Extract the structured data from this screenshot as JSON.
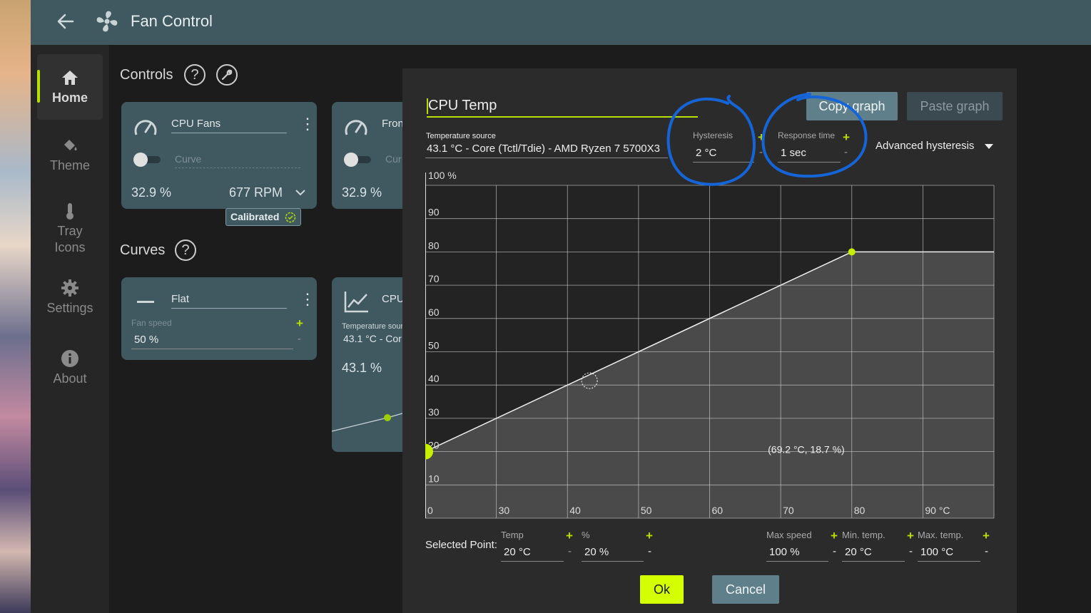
{
  "app": {
    "title": "Fan Control"
  },
  "sidebar": {
    "items": [
      {
        "label": "Home",
        "icon": "home-icon",
        "active": true
      },
      {
        "label": "Theme",
        "icon": "paint-bucket-icon"
      },
      {
        "label": "Tray\nIcons",
        "icon": "thermometer-icon"
      },
      {
        "label": "Settings",
        "icon": "gear-icon"
      },
      {
        "label": "About",
        "icon": "info-icon"
      }
    ]
  },
  "controls": {
    "title": "Controls",
    "help": "?",
    "cards": [
      {
        "name": "CPU Fans",
        "curve_placeholder": "Curve",
        "percent": "32.9 %",
        "rpm": "677 RPM",
        "badge": "Calibrated"
      },
      {
        "name": "Fron",
        "curve_placeholder": "Cur",
        "percent": "32.9 %"
      }
    ]
  },
  "curves": {
    "title": "Curves",
    "help": "?",
    "cards": [
      {
        "name": "Flat",
        "field_label": "Fan speed",
        "value": "50 %",
        "plus": "+",
        "minus": "-"
      },
      {
        "name": "CPU",
        "source_label": "Temperature sour",
        "source_value": "43.1 °C - Cor",
        "temp": "43.1 %"
      }
    ]
  },
  "dialog": {
    "curve_name": "CPU Temp",
    "copy_graph": "Copy graph",
    "paste_graph": "Paste graph",
    "temp_source_label": "Temperature source",
    "temp_source_value": "43.1 °C - Core (Tctl/Tdie) - AMD Ryzen 7 5700X3",
    "hysteresis_label": "Hysteresis",
    "hysteresis_value": "2 °C",
    "response_label": "Response time",
    "response_value": "1 sec",
    "plus": "+",
    "minus": "-",
    "advanced_hysteresis": "Advanced hysteresis",
    "hover_readout": "(69.2 °C, 18.7 %)",
    "selected_point_label": "Selected Point:",
    "temp_label": "Temp",
    "temp_value": "20 °C",
    "pct_label": "%",
    "pct_value": "20 %",
    "max_speed_label": "Max speed",
    "max_speed_value": "100 %",
    "min_temp_label": "Min. temp.",
    "min_temp_value": "20 °C",
    "max_temp_label": "Max. temp.",
    "max_temp_value": "100 °C",
    "ok": "Ok",
    "cancel": "Cancel"
  },
  "chart_data": {
    "type": "area",
    "x": [
      20,
      80,
      100
    ],
    "y": [
      20,
      80,
      80
    ],
    "selected_point": [
      20,
      20
    ],
    "points_marked": [
      [
        20,
        20
      ],
      [
        80,
        80
      ]
    ],
    "xlim": [
      20,
      100
    ],
    "ylim": [
      0,
      100
    ],
    "x_ticks": [
      "0",
      "30",
      "40",
      "50",
      "60",
      "70",
      "80",
      "90 °C"
    ],
    "y_ticks": [
      "10",
      "20",
      "30",
      "40",
      "50",
      "60",
      "70",
      "80",
      "90"
    ],
    "y_top_label": "100 %",
    "grid": true,
    "accent_color": "#c6f000"
  },
  "colors": {
    "accent": "#b7e000",
    "card": "#405860",
    "annotation": "#1565d8"
  }
}
